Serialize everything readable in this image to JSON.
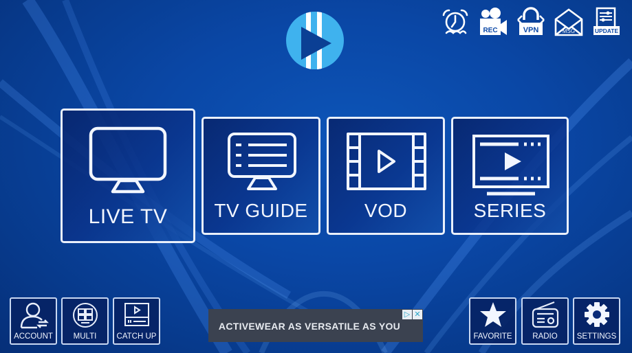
{
  "app": {
    "logo_icon": "play-logo-icon",
    "theme": {
      "background": "#0a47a6",
      "tile_border": "#e9f0fb",
      "logo_light": "#3fb2ee",
      "logo_dark": "#0b3f94"
    }
  },
  "top_bar": {
    "icons": [
      {
        "id": "alarm",
        "icon": "alarm-clock-icon",
        "label": ""
      },
      {
        "id": "rec",
        "icon": "video-camera-icon",
        "label": "REC"
      },
      {
        "id": "vpn",
        "icon": "lock-icon",
        "label": "VPN"
      },
      {
        "id": "msg",
        "icon": "envelope-icon",
        "label": "MSG"
      },
      {
        "id": "update",
        "icon": "document-update-icon",
        "label": "UPDATE"
      }
    ]
  },
  "main_menu": [
    {
      "id": "live-tv",
      "label": "LIVE TV",
      "icon": "tv-icon",
      "selected": true
    },
    {
      "id": "tv-guide",
      "label": "TV GUIDE",
      "icon": "tv-guide-icon",
      "selected": false
    },
    {
      "id": "vod",
      "label": "VOD",
      "icon": "film-play-icon",
      "selected": false
    },
    {
      "id": "series",
      "label": "SERIES",
      "icon": "series-play-icon",
      "selected": false
    }
  ],
  "bottom_left": [
    {
      "id": "account",
      "label": "ACCOUNT",
      "icon": "user-switch-icon"
    },
    {
      "id": "multi",
      "label": "MULTI",
      "icon": "multiscreen-icon"
    },
    {
      "id": "catch-up",
      "label": "CATCH UP",
      "icon": "catch-up-icon"
    }
  ],
  "bottom_right": [
    {
      "id": "favorite",
      "label": "FAVORITE",
      "icon": "star-icon"
    },
    {
      "id": "radio",
      "label": "RADIO",
      "icon": "radio-icon"
    },
    {
      "id": "settings",
      "label": "SETTINGS",
      "icon": "gear-icon"
    }
  ],
  "ad": {
    "text": "ACTIVEWEAR AS VERSATILE AS YOU",
    "adchoices_icon": "▷",
    "close_icon": "✕"
  }
}
